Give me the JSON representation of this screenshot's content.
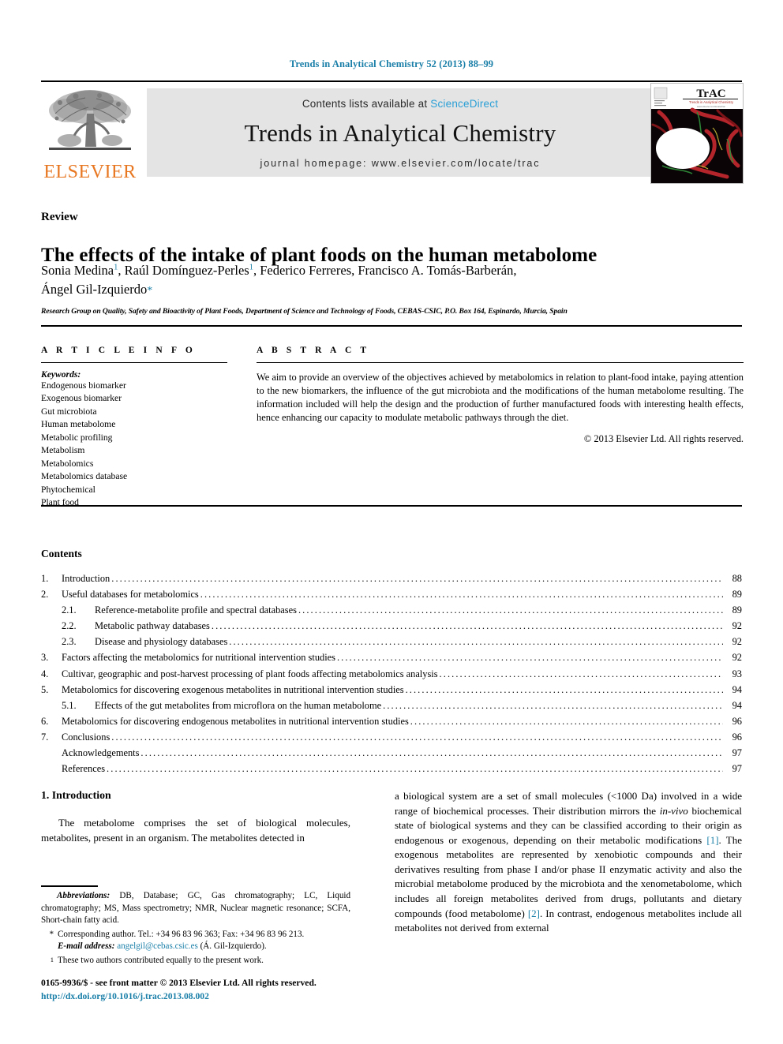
{
  "running_head": "Trends in Analytical Chemistry 52 (2013) 88–99",
  "masthead": {
    "publisher_name": "ELSEVIER",
    "contents_line": "Contents lists available at",
    "sciencedirect": "ScienceDirect",
    "journal_title": "Trends in Analytical Chemistry",
    "homepage": "journal homepage: www.elsevier.com/locate/trac",
    "cover": {
      "acronym": "TrAC",
      "subtitle": "Trends in Analytical Chemistry",
      "tagline": "www.elsevier.com/locate/trac"
    }
  },
  "article": {
    "type": "Review",
    "title": "The effects of the intake of plant foods on the human metabolome",
    "authors_line1": "Sonia Medina",
    "authors_line1_sup1": "1",
    "authors_line1_rest": ", Raúl Domínguez-Perles",
    "authors_line1_sup2": "1",
    "authors_line1_tail": ", Federico Ferreres, Francisco A. Tomás-Barberán,",
    "authors_line2": "Ángel Gil-Izquierdo",
    "authors_line2_star": "*",
    "affiliation": "Research Group on Quality, Safety and Bioactivity of Plant Foods, Department of Science and Technology of Foods, CEBAS-CSIC, P.O. Box 164, Espinardo, Murcia, Spain"
  },
  "article_info": {
    "heading": "A R T I C L E   I N F O",
    "keywords_label": "Keywords:",
    "keywords": [
      "Endogenous biomarker",
      "Exogenous biomarker",
      "Gut microbiota",
      "Human metabolome",
      "Metabolic profiling",
      "Metabolism",
      "Metabolomics",
      "Metabolomics database",
      "Phytochemical",
      "Plant food"
    ]
  },
  "abstract": {
    "heading": "A B S T R A C T",
    "text": "We aim to provide an overview of the objectives achieved by metabolomics in relation to plant-food intake, paying attention to the new biomarkers, the influence of the gut microbiota and the modifications of the human metabolome resulting. The information included will help the design and the production of further manufactured foods with interesting health effects, hence enhancing our capacity to modulate metabolic pathways through the diet.",
    "copyright": "© 2013 Elsevier Ltd. All rights reserved."
  },
  "contents": {
    "heading": "Contents",
    "entries": [
      {
        "num": "1.",
        "indent": false,
        "subnum": "",
        "label": "Introduction",
        "page": "88"
      },
      {
        "num": "2.",
        "indent": false,
        "subnum": "",
        "label": "Useful databases for metabolomics",
        "page": "89"
      },
      {
        "num": "",
        "indent": true,
        "subnum": "2.1.",
        "label": "Reference-metabolite profile and spectral databases",
        "page": "89"
      },
      {
        "num": "",
        "indent": true,
        "subnum": "2.2.",
        "label": "Metabolic pathway databases",
        "page": "92"
      },
      {
        "num": "",
        "indent": true,
        "subnum": "2.3.",
        "label": "Disease and physiology databases",
        "page": "92"
      },
      {
        "num": "3.",
        "indent": false,
        "subnum": "",
        "label": "Factors affecting the metabolomics for nutritional intervention studies",
        "page": "92"
      },
      {
        "num": "4.",
        "indent": false,
        "subnum": "",
        "label": "Cultivar, geographic and post-harvest processing of plant foods affecting metabolomics analysis",
        "page": "93"
      },
      {
        "num": "5.",
        "indent": false,
        "subnum": "",
        "label": "Metabolomics for discovering exogenous metabolites in nutritional intervention studies",
        "page": "94"
      },
      {
        "num": "",
        "indent": true,
        "subnum": "5.1.",
        "label": "Effects of the gut metabolites from microflora on the human metabolome",
        "page": "94"
      },
      {
        "num": "6.",
        "indent": false,
        "subnum": "",
        "label": "Metabolomics for discovering endogenous metabolites in nutritional intervention studies",
        "page": "96"
      },
      {
        "num": "7.",
        "indent": false,
        "subnum": "",
        "label": "Conclusions",
        "page": "96"
      },
      {
        "num": "",
        "indent": false,
        "subnum": "",
        "label": "Acknowledgements",
        "page": "97",
        "noindent_label": true
      },
      {
        "num": "",
        "indent": false,
        "subnum": "",
        "label": "References",
        "page": "97",
        "noindent_label": true
      }
    ]
  },
  "body": {
    "section_heading": "1. Introduction",
    "left_paragraph": "The metabolome comprises the set of biological molecules, metabolites, present in an organism. The metabolites detected in",
    "right_part1": "a biological system are a set of small molecules (<1000 Da) involved in a wide range of biochemical processes. Their distribution mirrors the ",
    "right_italic1": "in-vivo",
    "right_part2": " biochemical state of biological systems and they can be classified according to their origin as endogenous or exogenous, depending on their metabolic modifications ",
    "right_ref1": "[1]",
    "right_part3": ". The exogenous metabolites are represented by xenobiotic compounds and their derivatives resulting from phase I and/or phase II enzymatic activity and also the microbial metabolome produced by the microbiota and the xenometabolome, which includes all foreign metabolites derived from drugs, pollutants and dietary compounds (food metabolome) ",
    "right_ref2": "[2]",
    "right_part4": ". In contrast, endogenous metabolites include all metabolites not derived from external"
  },
  "footnotes": {
    "abbreviations_label": "Abbreviations:",
    "abbreviations_text": " DB, Database; GC, Gas chromatography; LC, Liquid chromatography; MS, Mass spectrometry; NMR, Nuclear magnetic resonance; SCFA, Short-chain fatty acid.",
    "corresponding_mark": "*",
    "corresponding_text": "Corresponding author. Tel.: +34 96 83 96 363; Fax: +34 96 83 96 213.",
    "email_label": "E-mail address:",
    "email": "angelgil@cebas.csic.es",
    "email_owner": " (Á. Gil-Izquierdo).",
    "equal_mark": "1",
    "equal_text": "These two authors contributed equally to the present work."
  },
  "footer": {
    "issn_line": "0165-9936/$ - see front matter © 2013 Elsevier Ltd. All rights reserved.",
    "doi": "http://dx.doi.org/10.1016/j.trac.2013.08.002"
  },
  "colors": {
    "link": "#1a7fa8",
    "elsevier_orange": "#E87722",
    "sciencedirect_blue": "#2a9fd6",
    "masthead_grey": "#e4e4e4"
  }
}
